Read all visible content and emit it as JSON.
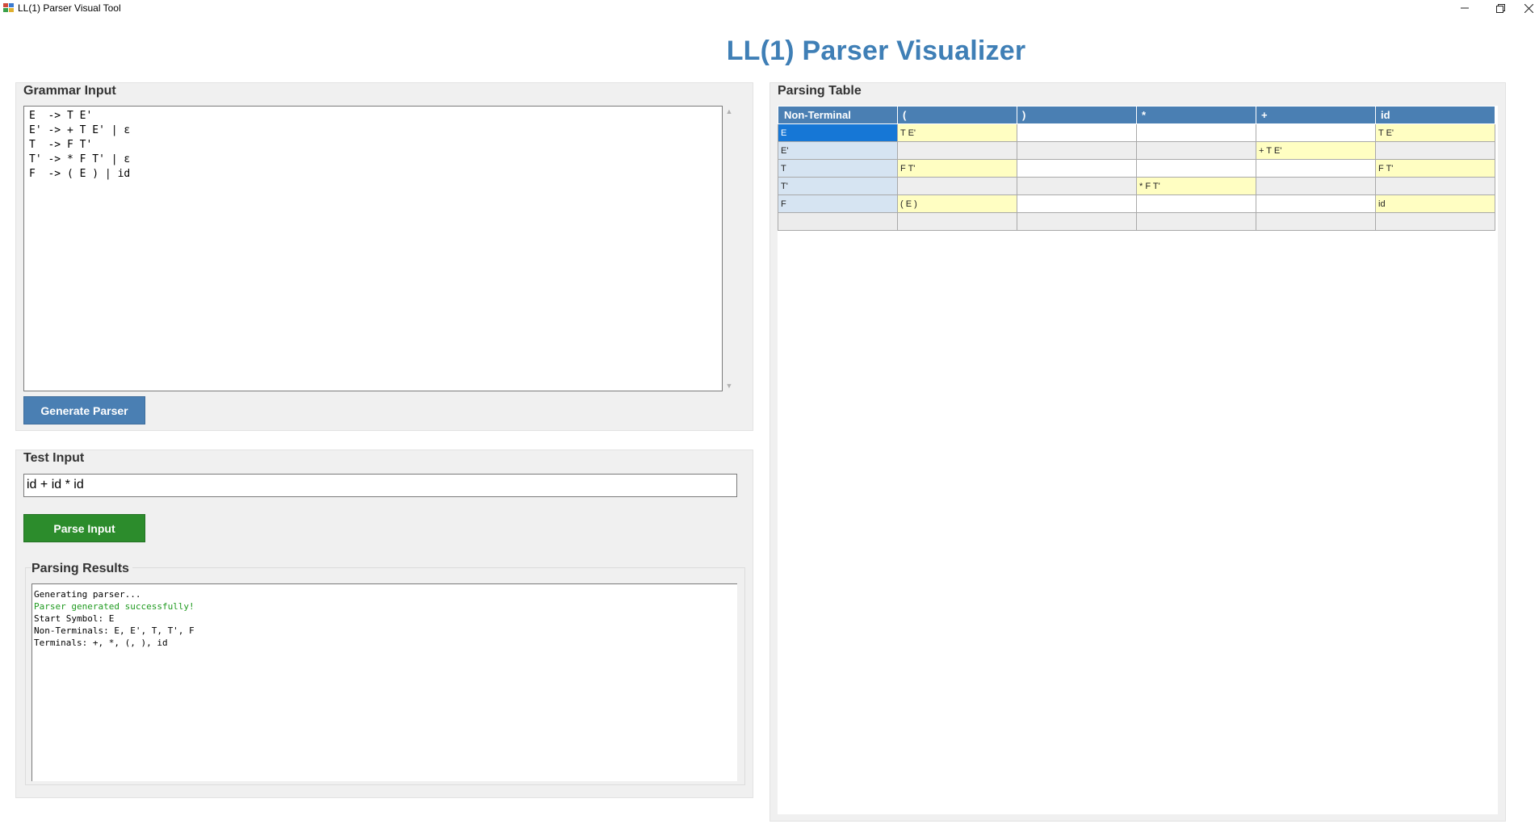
{
  "window": {
    "title": "LL(1) Parser Visual Tool"
  },
  "header": {
    "title": "LL(1) Parser Visualizer"
  },
  "grammar": {
    "group_title": "Grammar Input",
    "text": "E  -> T E'\nE' -> + T E' | ε\nT  -> F T'\nT' -> * F T' | ε\nF  -> ( E ) | id",
    "generate_label": "Generate Parser"
  },
  "test": {
    "group_title": "Test Input",
    "input_value": "id + id * id",
    "parse_label": "Parse Input"
  },
  "results": {
    "group_title": "Parsing Results",
    "lines": [
      {
        "text": "Generating parser...",
        "color": "#000000"
      },
      {
        "text": "Parser generated successfully!",
        "color": "#1f9a1f"
      },
      {
        "text": "Start Symbol: E",
        "color": "#000000"
      },
      {
        "text": "Non-Terminals: E, E', T, T', F",
        "color": "#000000"
      },
      {
        "text": "Terminals: +, *, (, ), id",
        "color": "#000000"
      }
    ]
  },
  "parsing_table": {
    "group_title": "Parsing Table",
    "headers": [
      "Non-Terminal",
      "(",
      ")",
      "*",
      "+",
      "id"
    ],
    "rows": [
      {
        "nt": "E",
        "cells": [
          "T E'",
          "",
          "",
          "",
          "T E'"
        ]
      },
      {
        "nt": "E'",
        "cells": [
          "",
          "",
          "",
          "+ T E'",
          ""
        ]
      },
      {
        "nt": "T",
        "cells": [
          "F T'",
          "",
          "",
          "",
          "F T'"
        ]
      },
      {
        "nt": "T'",
        "cells": [
          "",
          "",
          "* F T'",
          "",
          ""
        ]
      },
      {
        "nt": "F",
        "cells": [
          "( E )",
          "",
          "",
          "",
          "id"
        ]
      },
      {
        "nt": "",
        "cells": [
          "",
          "",
          "",
          "",
          ""
        ]
      }
    ],
    "selected_row": 0
  },
  "colors": {
    "accent": "#4a7fb3",
    "parse_button": "#2c8c2c",
    "success_text": "#1f9a1f",
    "filled_cell": "#fffec2",
    "selected_cell": "#1677d6"
  }
}
